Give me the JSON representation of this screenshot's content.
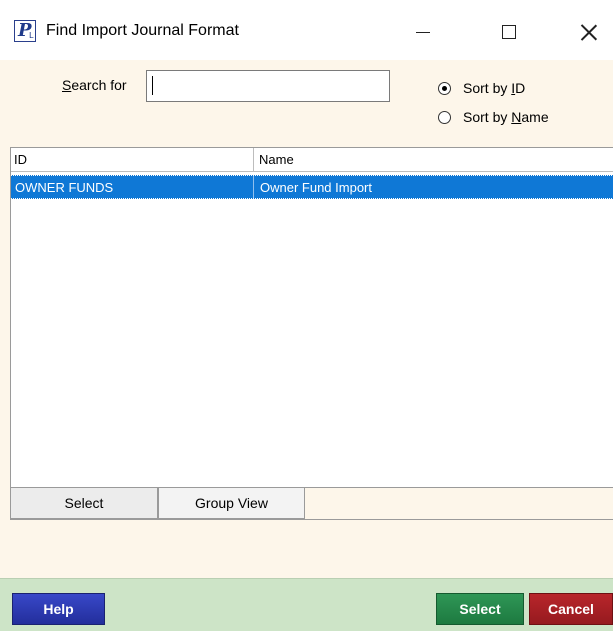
{
  "window": {
    "title": "Find Import Journal Format",
    "icon_letter": "P",
    "icon_sub": "L"
  },
  "search": {
    "label_prefix": "",
    "label_mnemonic": "S",
    "label_rest": "earch for",
    "value": "",
    "placeholder": ""
  },
  "sort": {
    "by_id_prefix": "Sort by ",
    "by_id_mnemonic": "I",
    "by_id_rest": "D",
    "by_name_prefix": "Sort by ",
    "by_name_mnemonic": "N",
    "by_name_rest": "ame",
    "selected": "id"
  },
  "grid": {
    "columns": [
      "ID",
      "Name"
    ],
    "rows": [
      {
        "id": "OWNER FUNDS",
        "name": "Owner Fund Import",
        "selected": true
      }
    ]
  },
  "tabs": [
    {
      "label": "Select"
    },
    {
      "label": "Group View"
    }
  ],
  "buttons": {
    "help": "Help",
    "select": "Select",
    "cancel": "Cancel"
  },
  "colors": {
    "selection": "#0f78d6",
    "help": "#2b38b0",
    "select": "#25864a",
    "cancel": "#a82025",
    "button_strip": "#cde4c7",
    "panel": "#fdf6ea"
  }
}
